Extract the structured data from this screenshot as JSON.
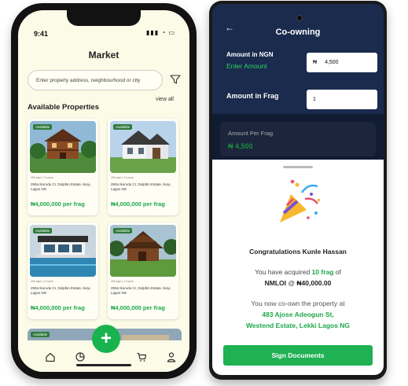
{
  "phone1": {
    "status": {
      "time": "9:41"
    },
    "header": {
      "title": "Market"
    },
    "search": {
      "placeholder": "Enter property address, neighbourhood or city"
    },
    "section": {
      "title": "Available Properties",
      "view_all": "view all"
    },
    "cards": [
      {
        "badge": "Available",
        "meta": "200 sqm | 3 rooms",
        "address": "250a Ikorodu Cr, Dolphin Estate, Ikoyi, Lagos NG",
        "price": "₦4,000,000 per frag"
      },
      {
        "badge": "Available",
        "meta": "200 sqm | 3 rooms",
        "address": "250a Ikorodu Cr, Dolphin Estate, Ikoyi, Lagos NG",
        "price": "₦4,000,000 per frag"
      },
      {
        "badge": "Available",
        "meta": "200 sqm | 3 rooms",
        "address": "250a Ikorodu Cr, Dolphin Estate, Ikoyi, Lagos NG",
        "price": "₦4,000,000 per frag"
      },
      {
        "badge": "Available",
        "meta": "200 sqm | 3 rooms",
        "address": "250a Ikorodu Cr, Dolphin Estate, Ikoyi, Lagos NG",
        "price": "₦4,000,000 per frag"
      },
      {
        "badge": "Available"
      }
    ],
    "nav": {
      "fab_label": "+"
    }
  },
  "phone2": {
    "header": {
      "title": "Co-owning"
    },
    "amount": {
      "label": "Amount in NGN",
      "hint": "Enter Amount",
      "currency": "₦",
      "value": "4,500"
    },
    "frag": {
      "label": "Amount in Frag",
      "value": "1"
    },
    "per_frag": {
      "label": "Amount Per Frag",
      "value": "₦ 4,500"
    },
    "modal": {
      "title": "Congratulations Kunle Hassan",
      "acquired_prefix": "You have acquired ",
      "acquired_amount": "10 frag",
      "acquired_of": " of",
      "property_code": "NMLOI",
      "at": " @ ",
      "price": "₦40,000.00",
      "own_text": "You now co-own the property at",
      "address_line1": "483 Ajose Adeogun St,",
      "address_line2": "Westend Estate, Lekki Lagos NG",
      "button": "Sign Documents"
    }
  },
  "colors": {
    "accent_green": "#1ea84a",
    "navy": "#1a2b4d",
    "cream": "#fbfbe7"
  }
}
